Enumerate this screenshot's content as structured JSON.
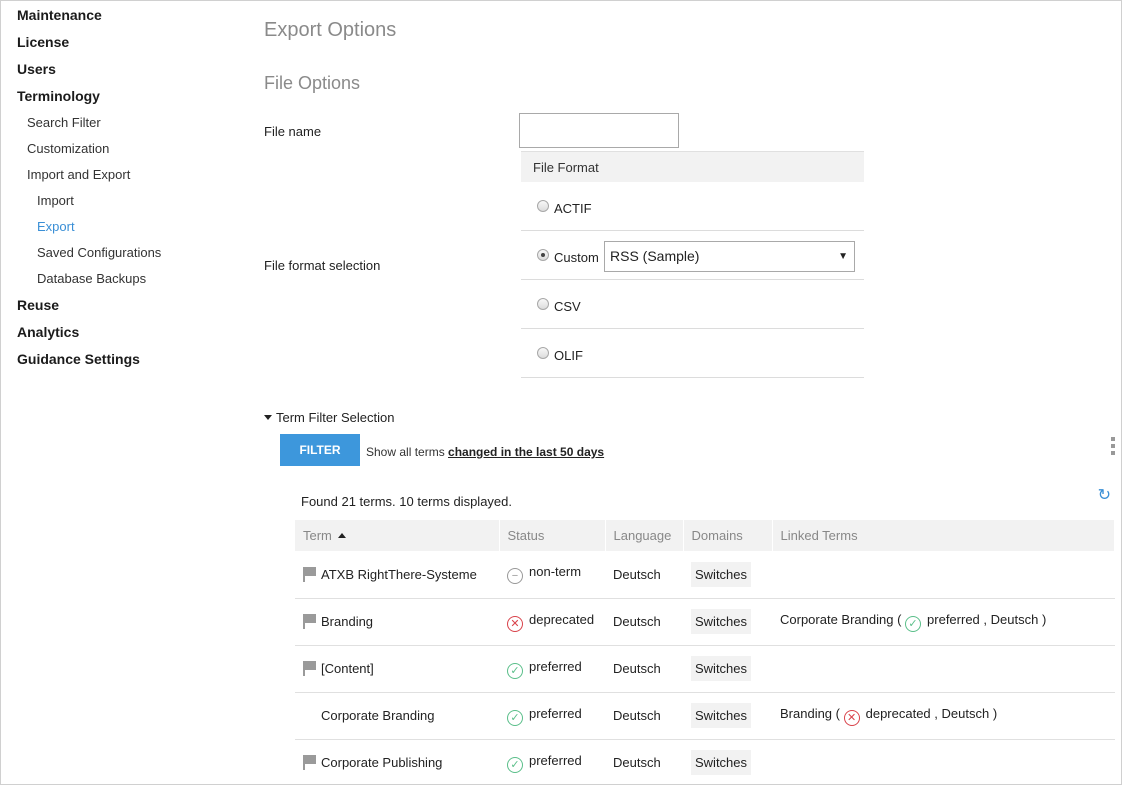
{
  "sidebar": {
    "maintenance": "Maintenance",
    "license": "License",
    "users": "Users",
    "terminology": "Terminology",
    "search_filter": "Search Filter",
    "customization": "Customization",
    "import_export": "Import and Export",
    "import": "Import",
    "export": "Export",
    "saved_configs": "Saved Configurations",
    "db_backups": "Database Backups",
    "reuse": "Reuse",
    "analytics": "Analytics",
    "guidance": "Guidance Settings",
    "active_color": "#3a8fd6"
  },
  "main": {
    "title": "Export Options",
    "section": "File Options",
    "file_name_label": "File name",
    "file_name_value": "",
    "file_format_label": "File format selection",
    "format_header": "File Format",
    "formats": {
      "actif": "ACTIF",
      "custom": "Custom",
      "custom_selected": "RSS (Sample)",
      "csv": "CSV",
      "olif": "OLIF"
    },
    "term_filter_toggle": "Term Filter Selection",
    "filter_button": "FILTER",
    "filter_desc_prefix": "Show all terms ",
    "filter_desc_link": "changed in the last 50 days",
    "found_text": "Found 21 terms.  10 terms displayed.",
    "filter_button_color": "#3d97dc"
  },
  "table": {
    "headers": {
      "term": "Term",
      "status": "Status",
      "language": "Language",
      "domains": "Domains",
      "linked": "Linked Terms"
    },
    "rows": [
      {
        "term": "ATXB RightThere-Systeme",
        "status": "non-term",
        "language": "Deutsch",
        "domain": "Switches",
        "linked_term": "",
        "linked_status": "",
        "linked_lang": ""
      },
      {
        "term": "Branding",
        "status": "deprecated",
        "language": "Deutsch",
        "domain": "Switches",
        "linked_term": "Corporate Branding",
        "linked_status": "preferred",
        "linked_lang": "Deutsch"
      },
      {
        "term": "[Content]",
        "status": "preferred",
        "language": "Deutsch",
        "domain": "Switches",
        "linked_term": "",
        "linked_status": "",
        "linked_lang": ""
      },
      {
        "term": "Corporate Branding",
        "status": "preferred",
        "language": "Deutsch",
        "domain": "Switches",
        "linked_term": "Branding",
        "linked_status": "deprecated",
        "linked_lang": "Deutsch"
      },
      {
        "term": "Corporate Publishing",
        "status": "preferred",
        "language": "Deutsch",
        "domain": "Switches",
        "linked_term": "",
        "linked_status": "",
        "linked_lang": ""
      }
    ],
    "status_colors": {
      "non-term": "#999999",
      "deprecated": "#d9434b",
      "preferred": "#5bbf8a"
    }
  }
}
